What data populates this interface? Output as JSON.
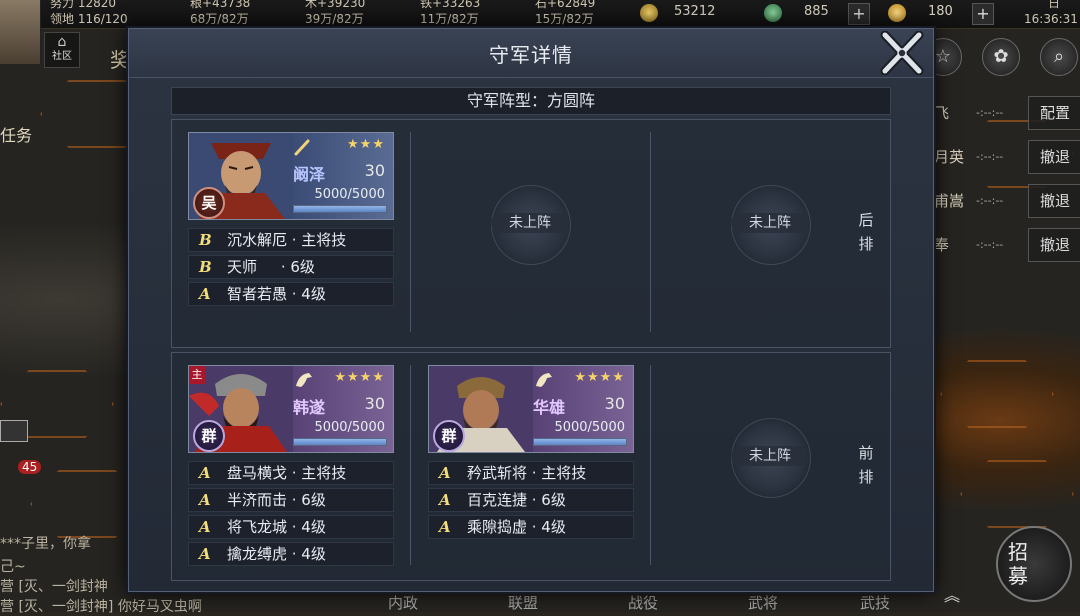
{
  "topbar": {
    "stat1_label": "努力 12820",
    "stat2_label": "领地 116/120",
    "res": [
      {
        "top": "粮+43738",
        "bottom": "68万/82万"
      },
      {
        "top": "木+39230",
        "bottom": "39万/82万"
      },
      {
        "top": "铁+33263",
        "bottom": "11万/82万"
      },
      {
        "top": "石+62849",
        "bottom": "15万/82万"
      }
    ],
    "copper": "53212",
    "jade": "885",
    "gold": "180",
    "time": "16:36:31",
    "time_top": "日"
  },
  "left": {
    "community": "社区",
    "task": "任务",
    "badge_count": "45",
    "tab_partial": "奖"
  },
  "right": {
    "config": "配置",
    "withdraw": "撤退",
    "rows": [
      {
        "name": "飞",
        "time": "-:--:--"
      },
      {
        "name": "月英",
        "time": "-:--:--"
      },
      {
        "name": "甫嵩",
        "time": "-:--:--"
      },
      {
        "name": "奉",
        "time": "-:--:--"
      }
    ],
    "recruit": "招募"
  },
  "chat": [
    "***子里，你拿",
    "己~",
    "营 [灭、一剑封神",
    "营 [灭、一剑封神] 你好马叉虫啊"
  ],
  "bottom_nav": [
    "内政",
    "联盟",
    "战役",
    "武将",
    "武技"
  ],
  "modal": {
    "title": "守军详情",
    "formation": "守军阵型：方圆阵",
    "back_label": "后排",
    "front_label": "前排",
    "empty_slot": "未上阵",
    "heroes": {
      "kanze": {
        "name": "阚泽",
        "level": "30",
        "stars": "★★★",
        "troops": "5000/5000",
        "troop_ratio": 1.0,
        "faction": "吴",
        "skills": [
          {
            "grade": "B",
            "name": "沉水解厄 · 主将技"
          },
          {
            "grade": "B",
            "name": "天师     · 6级"
          },
          {
            "grade": "A",
            "name": "智者若愚 · 4级"
          }
        ]
      },
      "hansui": {
        "name": "韩遂",
        "level": "30",
        "stars": "★★★★",
        "troops": "5000/5000",
        "troop_ratio": 1.0,
        "faction": "群",
        "main_tag": "主",
        "skills": [
          {
            "grade": "A",
            "name": "盘马横戈 · 主将技"
          },
          {
            "grade": "A",
            "name": "半济而击 · 6级"
          },
          {
            "grade": "A",
            "name": "将飞龙城 · 4级"
          },
          {
            "grade": "A",
            "name": "擒龙缚虎 · 4级"
          }
        ]
      },
      "huaxiong": {
        "name": "华雄",
        "level": "30",
        "stars": "★★★★",
        "troops": "5000/5000",
        "troop_ratio": 1.0,
        "faction": "群",
        "skills": [
          {
            "grade": "A",
            "name": "矜武斩将 · 主将技"
          },
          {
            "grade": "A",
            "name": "百克连捷 · 6级"
          },
          {
            "grade": "A",
            "name": "乘隙捣虚 · 4级"
          }
        ]
      }
    }
  },
  "colors": {
    "modal_bg": "#2c3442",
    "skill_grade": "#f3dd7a",
    "star": "#f5d36a",
    "hex_border": "#c0641d"
  }
}
